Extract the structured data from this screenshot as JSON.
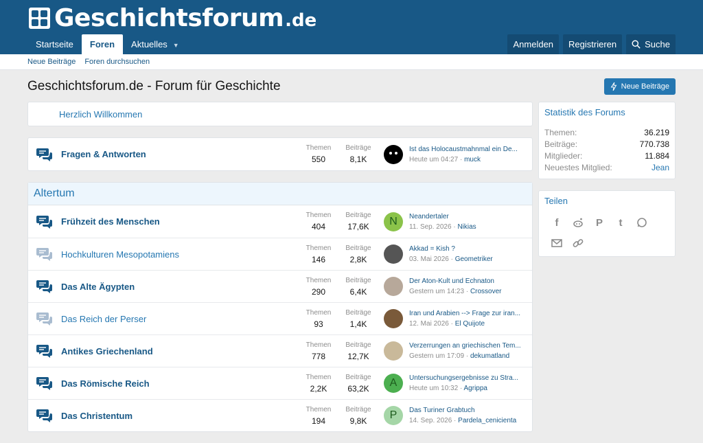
{
  "brand": {
    "name": "Geschichtsforum",
    "tld": ".de"
  },
  "nav": {
    "tabs": [
      {
        "label": "Startseite"
      },
      {
        "label": "Foren"
      },
      {
        "label": "Aktuelles"
      }
    ],
    "login": "Anmelden",
    "register": "Registrieren",
    "search": "Suche"
  },
  "subnav": {
    "new_posts": "Neue Beiträge",
    "search_forums": "Foren durchsuchen"
  },
  "page": {
    "title": "Geschichtsforum.de - Forum für Geschichte",
    "new_posts_button": "Neue Beiträge"
  },
  "welcome": "Herzlich Willkommen",
  "labels": {
    "threads": "Themen",
    "posts": "Beiträge"
  },
  "qa": {
    "title": "Fragen & Antworten",
    "threads": "550",
    "posts": "8,1K",
    "last_title": "Ist das Holocaustmahnmal ein De...",
    "last_date": "Heute um 04:27",
    "last_user": "muck"
  },
  "category": {
    "title": "Altertum",
    "forums": [
      {
        "title": "Frühzeit des Menschen",
        "threads": "404",
        "posts": "17,6K",
        "last_title": "Neandertaler",
        "last_date": "11. Sep. 2026",
        "last_user": "Nikias",
        "avatar_letter": "N",
        "avatar_color": "#8bc34a"
      },
      {
        "title": "Hochkulturen Mesopotamiens",
        "threads": "146",
        "posts": "2,8K",
        "last_title": "Akkad = Kish ?",
        "last_date": "03. Mai 2026",
        "last_user": "Geometriker",
        "avatar_letter": "",
        "avatar_color": "#555555"
      },
      {
        "title": "Das Alte Ägypten",
        "threads": "290",
        "posts": "6,4K",
        "last_title": "Der Aton-Kult und Echnaton",
        "last_date": "Gestern um 14:23",
        "last_user": "Crossover",
        "avatar_letter": "",
        "avatar_color": "#b7a89a"
      },
      {
        "title": "Das Reich der Perser",
        "threads": "93",
        "posts": "1,4K",
        "last_title": "Iran und Arabien --> Frage zur iran...",
        "last_date": "12. Mai 2026",
        "last_user": "El Quijote",
        "avatar_letter": "",
        "avatar_color": "#7a5a3a"
      },
      {
        "title": "Antikes Griechenland",
        "threads": "778",
        "posts": "12,7K",
        "last_title": "Verzerrungen an griechischen Tem...",
        "last_date": "Gestern um 17:09",
        "last_user": "dekumatland",
        "avatar_letter": "",
        "avatar_color": "#c9b99a"
      },
      {
        "title": "Das Römische Reich",
        "threads": "2,2K",
        "posts": "63,2K",
        "last_title": "Untersuchungsergebnisse zu Stra...",
        "last_date": "Heute um 10:32",
        "last_user": "Agrippa",
        "avatar_letter": "A",
        "avatar_color": "#4caf50"
      },
      {
        "title": "Das Christentum",
        "threads": "194",
        "posts": "9,8K",
        "last_title": "Das Turiner Grabtuch",
        "last_date": "14. Sep. 2026",
        "last_user": "Pardela_cenicienta",
        "avatar_letter": "P",
        "avatar_color": "#a5d6a7"
      }
    ]
  },
  "stats": {
    "title": "Statistik des Forums",
    "rows": [
      {
        "k": "Themen:",
        "v": "36.219"
      },
      {
        "k": "Beiträge:",
        "v": "770.738"
      },
      {
        "k": "Mitglieder:",
        "v": "11.884"
      },
      {
        "k": "Neuestes Mitglied:",
        "v": "Jean"
      }
    ]
  },
  "share": {
    "title": "Teilen",
    "icons": [
      "facebook-icon",
      "reddit-icon",
      "pinterest-icon",
      "tumblr-icon",
      "whatsapp-icon",
      "email-icon",
      "link-icon"
    ]
  },
  "colors": {
    "header": "#185886",
    "link": "#2577b1",
    "button": "#2577b1"
  }
}
